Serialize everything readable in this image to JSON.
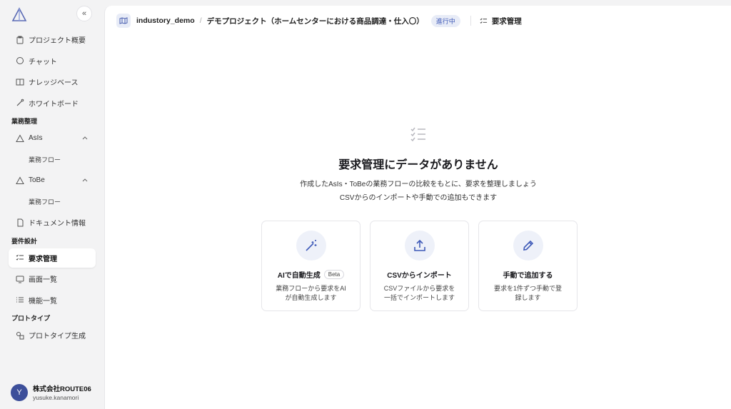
{
  "sidebar": {
    "nav": [
      {
        "label": "プロジェクト概要",
        "icon": "clipboard-icon"
      },
      {
        "label": "チャット",
        "icon": "chat-icon"
      },
      {
        "label": "ナレッジベース",
        "icon": "book-icon"
      },
      {
        "label": "ホワイトボード",
        "icon": "brush-icon"
      }
    ],
    "section_business": "業務整理",
    "asis": {
      "label": "AsIs",
      "sub": "業務フロー"
    },
    "tobe": {
      "label": "ToBe",
      "sub": "業務フロー"
    },
    "document": "ドキュメント情報",
    "section_requirements": "要件設計",
    "requirements": "要求管理",
    "screens": "画面一覧",
    "functions": "機能一覧",
    "section_prototype": "プロトタイプ",
    "prototype": "プロトタイプ生成",
    "user": {
      "initial": "Y",
      "org": "株式会社ROUTE06",
      "name": "yusuke.kanamori"
    }
  },
  "header": {
    "project": "industory_demo",
    "separator": "/",
    "project_title": "デモプロジェクト（ホームセンターにおける商品調達・仕入〇）",
    "status": "進行中",
    "page": "要求管理"
  },
  "empty_state": {
    "title": "要求管理にデータがありません",
    "line1": "作成したAsIs・ToBeの業務フローの比較をもとに、要求を整理しましょう",
    "line2": "CSVからのインポートや手動での追加もできます"
  },
  "cards": [
    {
      "title": "AIで自動生成",
      "badge": "Beta",
      "desc1": "業務フローから要求をAI",
      "desc2": "が自動生成します"
    },
    {
      "title": "CSVからインポート",
      "desc1": "CSVファイルから要求を",
      "desc2": "一括でインポートします"
    },
    {
      "title": "手動で追加する",
      "desc1": "要求を1件ずつ手動で登",
      "desc2": "録します"
    }
  ],
  "colors": {
    "accent": "#3f5ab8",
    "avatar": "#3d4f9a"
  }
}
